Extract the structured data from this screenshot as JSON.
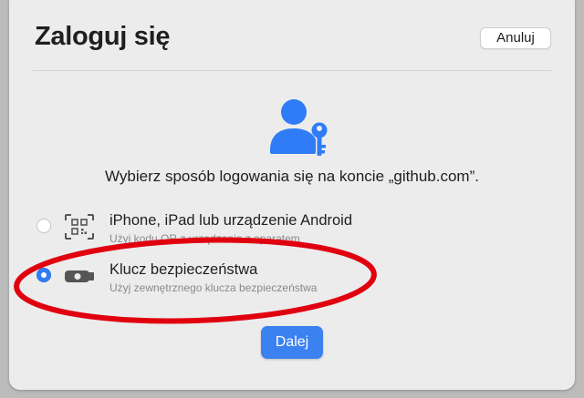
{
  "dialog": {
    "title": "Zaloguj się",
    "cancel_label": "Anuluj",
    "prompt": "Wybierz sposób logowania się na koncie „github.com”.",
    "next_label": "Dalej"
  },
  "options": [
    {
      "label": "iPhone, iPad lub urządzenie Android",
      "sublabel": "Użyj kodu QR z urządzenia z aparatem",
      "icon": "qr-code-icon",
      "selected": false
    },
    {
      "label": "Klucz bezpieczeństwa",
      "sublabel": "Użyj zewnętrznego klucza bezpieczeństwa",
      "icon": "security-key-icon",
      "selected": true
    }
  ],
  "colors": {
    "accent": "#3b82f0",
    "annotation_ring": "#e0000f",
    "dialog_bg": "#ececec"
  }
}
